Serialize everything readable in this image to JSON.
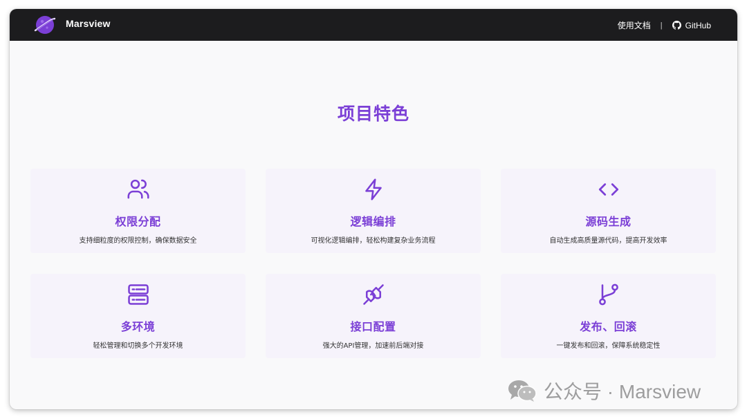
{
  "navbar": {
    "brand": "Marsview",
    "docs_link": "使用文档",
    "separator": "|",
    "github_link": "GitHub"
  },
  "section": {
    "title": "项目特色"
  },
  "features": [
    {
      "icon": "users-icon",
      "title": "权限分配",
      "desc": "支持细粒度的权限控制，确保数据安全"
    },
    {
      "icon": "lightning-icon",
      "title": "逻辑编排",
      "desc": "可视化逻辑编排，轻松构建复杂业务流程"
    },
    {
      "icon": "code-icon",
      "title": "源码生成",
      "desc": "自动生成高质量源代码，提高开发效率"
    },
    {
      "icon": "server-icon",
      "title": "多环境",
      "desc": "轻松管理和切换多个开发环境"
    },
    {
      "icon": "plug-icon",
      "title": "接口配置",
      "desc": "强大的API管理，加速前后端对接"
    },
    {
      "icon": "git-branch-icon",
      "title": "发布、回滚",
      "desc": "一键发布和回滚，保障系统稳定性"
    }
  ],
  "watermark": {
    "text": "公众号 · Marsview"
  },
  "colors": {
    "accent": "#7b3fd6",
    "navbar_bg": "#1c1c1e",
    "card_bg": "#f6f3fb",
    "page_bg": "#f9f9fa"
  }
}
